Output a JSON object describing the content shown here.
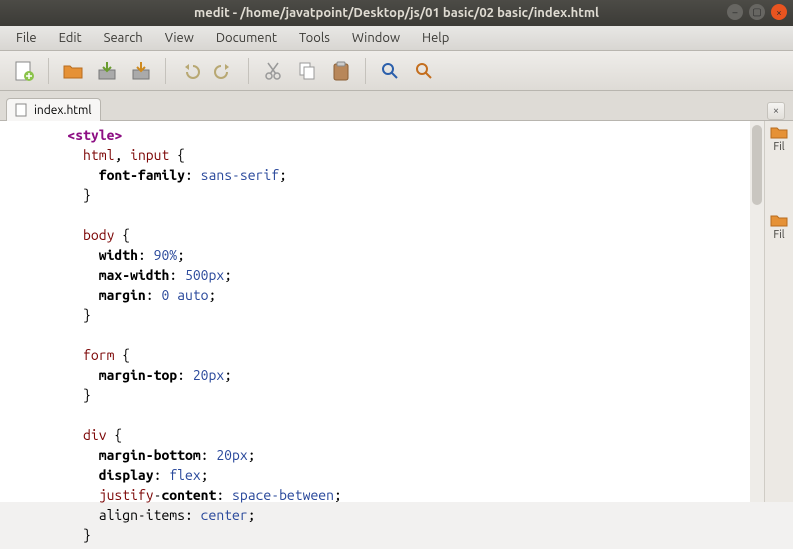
{
  "window": {
    "title": "medit - /home/javatpoint/Desktop/js/01 basic/02 basic/index.html"
  },
  "menubar": [
    "File",
    "Edit",
    "Search",
    "View",
    "Document",
    "Tools",
    "Window",
    "Help"
  ],
  "tab": {
    "label": "index.html"
  },
  "sidepanel": {
    "label1": "Fil",
    "label2": "Fil"
  },
  "code": {
    "l1_indent": "    ",
    "l1_tag_open": "<style>",
    "l2_indent": "      ",
    "l2_sel": "html",
    "l2_comma": ", ",
    "l2_sel2": "input",
    "l2_brace": " {",
    "l3_indent": "        ",
    "l3_prop": "font-family",
    "l3_colon": ": ",
    "l3_val": "sans-serif",
    "l3_semi": ";",
    "l4_indent": "      ",
    "l4_brace": "}",
    "l5_blank": "",
    "l6_indent": "      ",
    "l6_sel": "body",
    "l6_brace": " {",
    "l7_indent": "        ",
    "l7_prop": "width",
    "l7_colon": ": ",
    "l7_val": "90%",
    "l7_semi": ";",
    "l8_indent": "        ",
    "l8_prop": "max-width",
    "l8_colon": ": ",
    "l8_val": "500px",
    "l8_semi": ";",
    "l9_indent": "        ",
    "l9_prop": "margin",
    "l9_colon": ": ",
    "l9_val": "0 auto",
    "l9_semi": ";",
    "l10_indent": "      ",
    "l10_brace": "}",
    "l11_blank": "",
    "l12_indent": "      ",
    "l12_sel": "form",
    "l12_brace": " {",
    "l13_indent": "        ",
    "l13_prop": "margin-top",
    "l13_colon": ": ",
    "l13_val": "20px",
    "l13_semi": ";",
    "l14_indent": "      ",
    "l14_brace": "}",
    "l15_blank": "",
    "l16_indent": "      ",
    "l16_sel": "div",
    "l16_brace": " {",
    "l17_indent": "        ",
    "l17_prop": "margin-bottom",
    "l17_colon": ": ",
    "l17_val": "20px",
    "l17_semi": ";",
    "l18_indent": "        ",
    "l18_prop": "display",
    "l18_colon": ": ",
    "l18_val": "flex",
    "l18_semi": ";",
    "l19_indent": "        ",
    "l19_prop1": "justify",
    "l19_dash": "-",
    "l19_prop2": "content",
    "l19_colon": ": ",
    "l19_val": "space-between",
    "l19_semi": ";",
    "l20_indent": "        ",
    "l20_prop": "align-items",
    "l20_colon": ": ",
    "l20_val": "center",
    "l20_semi": ";",
    "l21_indent": "      ",
    "l21_brace": "}"
  }
}
